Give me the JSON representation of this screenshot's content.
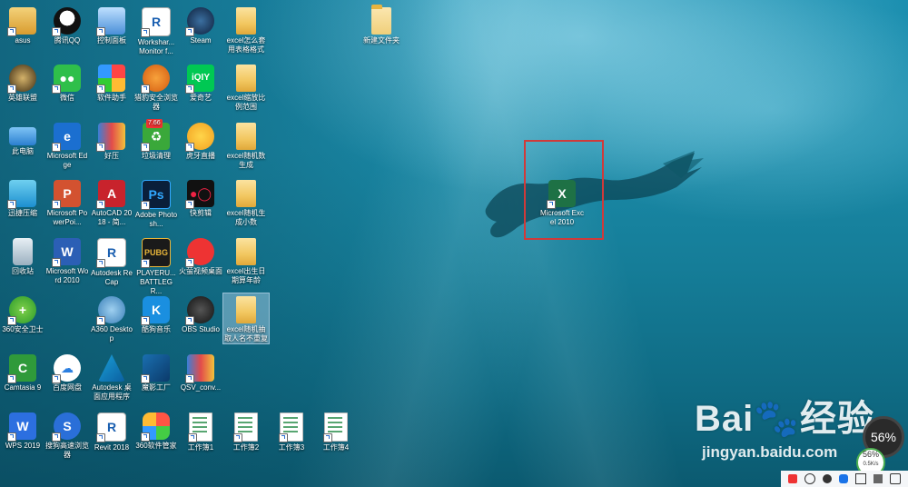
{
  "desktop": {
    "icons": [
      {
        "label": "asus"
      },
      {
        "label": "腾讯QQ"
      },
      {
        "label": "控制面板"
      },
      {
        "label": "Workshar... Monitor f..."
      },
      {
        "label": "Steam"
      },
      {
        "label": "excel怎么套用表格格式"
      },
      {
        "label": "新建文件夹"
      },
      {
        "label": "英雄联盟"
      },
      {
        "label": "微信"
      },
      {
        "label": "软件助手"
      },
      {
        "label": "猎豹安全浏览器"
      },
      {
        "label": "爱奇艺"
      },
      {
        "label": "excel缩放比例范围"
      },
      {
        "label": "此电脑"
      },
      {
        "label": "Microsoft Edge"
      },
      {
        "label": "好压"
      },
      {
        "label": "垃圾清理"
      },
      {
        "label": "虎牙直播"
      },
      {
        "label": "excel随机数生成"
      },
      {
        "label": "迅捷压缩"
      },
      {
        "label": "Microsoft PowerPoi..."
      },
      {
        "label": "AutoCAD 2018 - 简..."
      },
      {
        "label": "Adobe Photosh..."
      },
      {
        "label": "快剪辑"
      },
      {
        "label": "excel随机生成小数"
      },
      {
        "label": "回收站"
      },
      {
        "label": "Microsoft Word 2010"
      },
      {
        "label": "Autodesk ReCap"
      },
      {
        "label": "PLAYERU... BATTLEGR..."
      },
      {
        "label": "火萤视频桌面"
      },
      {
        "label": "excel出生日期算年龄"
      },
      {
        "label": "360安全卫士"
      },
      {
        "label": "A360 Desktop"
      },
      {
        "label": "酷狗音乐"
      },
      {
        "label": "OBS Studio"
      },
      {
        "label": "excel随机抽取人名不重复"
      },
      {
        "label": "Camtasia 9"
      },
      {
        "label": "百度网盘"
      },
      {
        "label": "Autodesk 桌面应用程序"
      },
      {
        "label": "魔影工厂"
      },
      {
        "label": "QSV_conv..."
      },
      {
        "label": "WPS 2019"
      },
      {
        "label": "搜狗高速浏览器"
      },
      {
        "label": "Revit 2018"
      },
      {
        "label": "360软件管家"
      },
      {
        "label": "工作簿1"
      },
      {
        "label": "工作簿2"
      },
      {
        "label": "工作簿3"
      },
      {
        "label": "工作簿4"
      }
    ],
    "selected_item": {
      "label": "Microsoft Excel 2010"
    },
    "badge_text": "7.66"
  },
  "overlay": {
    "watermark_main": "Bai🐾经验",
    "watermark_sub": "jingyan.baidu.com",
    "meter_big": "56%",
    "meter_small": "56%",
    "meter_small_sub": "0.5K/s"
  },
  "colors": {
    "selection_box": "#d03a3a",
    "water_top": "#1b8fb0",
    "water_bottom": "#0b5a70"
  }
}
